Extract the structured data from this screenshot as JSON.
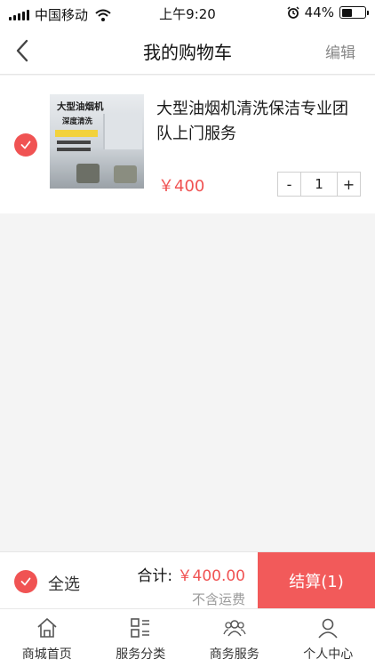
{
  "status_bar": {
    "carrier": "中国移动",
    "time": "上午9:20",
    "battery_percent": "44%",
    "battery_level": 0.44
  },
  "nav": {
    "title": "我的购物车",
    "edit_label": "编辑"
  },
  "cart": {
    "items": [
      {
        "title": "大型油烟机清洗保洁专业团队上门服务",
        "price": "￥400",
        "quantity": "1",
        "checked": true,
        "thumbnail": {
          "headline": "大型油烟机",
          "subline": "深度清洗"
        }
      }
    ]
  },
  "checkout": {
    "select_all_label": "全选",
    "total_label": "合计:",
    "total_amount": "￥400.00",
    "shipping_note": "不含运费",
    "checkout_label": "结算(1)"
  },
  "tabs": [
    {
      "label": "商城首页",
      "icon": "home-icon"
    },
    {
      "label": "服务分类",
      "icon": "category-icon"
    },
    {
      "label": "商务服务",
      "icon": "business-icon"
    },
    {
      "label": "个人中心",
      "icon": "user-icon"
    }
  ],
  "colors": {
    "accent": "#f05353",
    "checkout_button": "#f25a5a"
  }
}
